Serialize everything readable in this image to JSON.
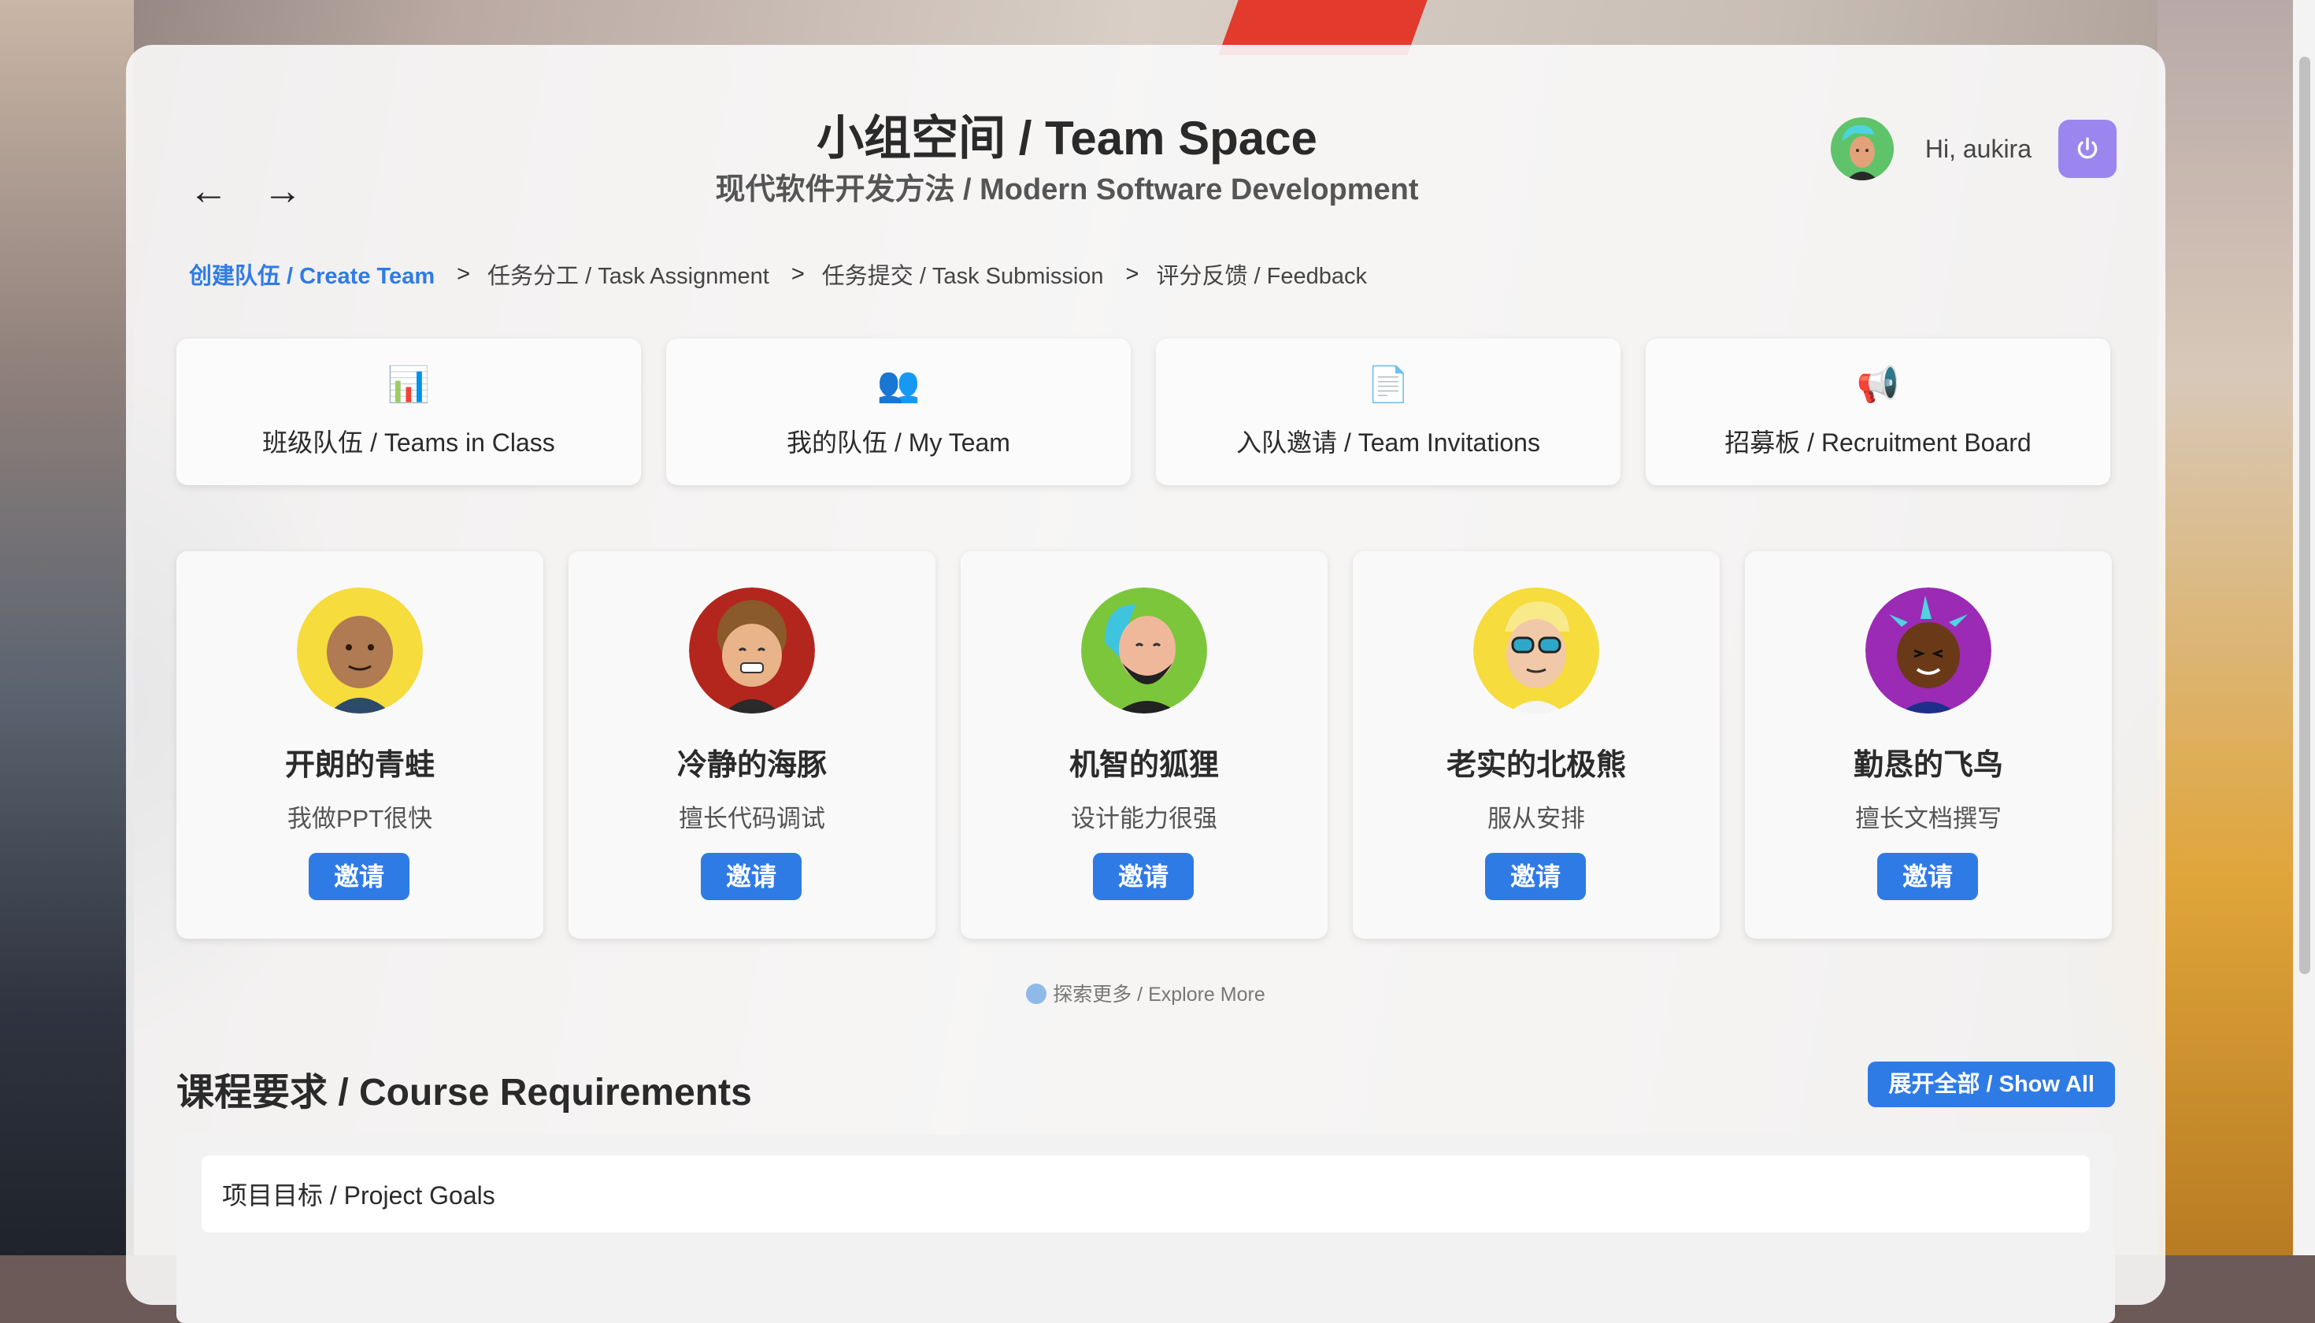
{
  "header": {
    "title": "小组空间 / Team Space",
    "subtitle": "现代软件开发方法 / Modern Software Development",
    "back_icon": "←",
    "forward_icon": "→"
  },
  "user": {
    "greeting": "Hi, aukira",
    "avatar_icon": "user-avatar-icon",
    "logout_icon": "power-icon"
  },
  "breadcrumb": {
    "items": [
      "创建队伍 / Create Team",
      "任务分工 / Task Assignment",
      "任务提交 / Task Submission",
      "评分反馈 / Feedback"
    ],
    "separator": ">"
  },
  "tiles": [
    {
      "icon": "📊",
      "label": "班级队伍 / Teams in Class"
    },
    {
      "icon": "👥",
      "label": "我的队伍 / My Team"
    },
    {
      "icon": "📄",
      "label": "入队邀请 / Team Invitations"
    },
    {
      "icon": "📢",
      "label": "招募板 / Recruitment Board"
    }
  ],
  "members": [
    {
      "name": "开朗的青蛙",
      "desc": "我做PPT很快",
      "button": "邀请"
    },
    {
      "name": "冷静的海豚",
      "desc": "擅长代码调试",
      "button": "邀请"
    },
    {
      "name": "机智的狐狸",
      "desc": "设计能力很强",
      "button": "邀请"
    },
    {
      "name": "老实的北极熊",
      "desc": "服从安排",
      "button": "邀请"
    },
    {
      "name": "勤恳的飞鸟",
      "desc": "擅长文档撰写",
      "button": "邀请"
    }
  ],
  "explore": "探索更多 / Explore More",
  "requirements": {
    "title": "课程要求 / Course Requirements",
    "show_all": "展开全部 / Show All",
    "items": [
      "项目目标 / Project Goals"
    ]
  },
  "colors": {
    "accent": "#2f7be6",
    "logout": "#9b86f0"
  }
}
